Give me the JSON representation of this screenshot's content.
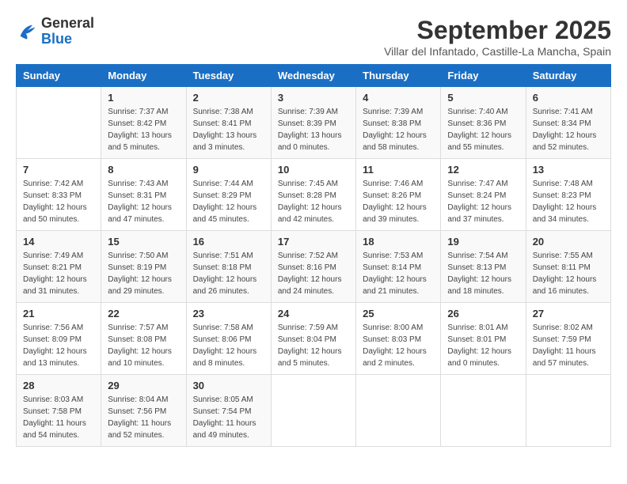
{
  "header": {
    "logo_general": "General",
    "logo_blue": "Blue",
    "month_title": "September 2025",
    "subtitle": "Villar del Infantado, Castille-La Mancha, Spain"
  },
  "weekdays": [
    "Sunday",
    "Monday",
    "Tuesday",
    "Wednesday",
    "Thursday",
    "Friday",
    "Saturday"
  ],
  "weeks": [
    [
      {
        "day": "",
        "sunrise": "",
        "sunset": "",
        "daylight": ""
      },
      {
        "day": "1",
        "sunrise": "Sunrise: 7:37 AM",
        "sunset": "Sunset: 8:42 PM",
        "daylight": "Daylight: 13 hours and 5 minutes."
      },
      {
        "day": "2",
        "sunrise": "Sunrise: 7:38 AM",
        "sunset": "Sunset: 8:41 PM",
        "daylight": "Daylight: 13 hours and 3 minutes."
      },
      {
        "day": "3",
        "sunrise": "Sunrise: 7:39 AM",
        "sunset": "Sunset: 8:39 PM",
        "daylight": "Daylight: 13 hours and 0 minutes."
      },
      {
        "day": "4",
        "sunrise": "Sunrise: 7:39 AM",
        "sunset": "Sunset: 8:38 PM",
        "daylight": "Daylight: 12 hours and 58 minutes."
      },
      {
        "day": "5",
        "sunrise": "Sunrise: 7:40 AM",
        "sunset": "Sunset: 8:36 PM",
        "daylight": "Daylight: 12 hours and 55 minutes."
      },
      {
        "day": "6",
        "sunrise": "Sunrise: 7:41 AM",
        "sunset": "Sunset: 8:34 PM",
        "daylight": "Daylight: 12 hours and 52 minutes."
      }
    ],
    [
      {
        "day": "7",
        "sunrise": "Sunrise: 7:42 AM",
        "sunset": "Sunset: 8:33 PM",
        "daylight": "Daylight: 12 hours and 50 minutes."
      },
      {
        "day": "8",
        "sunrise": "Sunrise: 7:43 AM",
        "sunset": "Sunset: 8:31 PM",
        "daylight": "Daylight: 12 hours and 47 minutes."
      },
      {
        "day": "9",
        "sunrise": "Sunrise: 7:44 AM",
        "sunset": "Sunset: 8:29 PM",
        "daylight": "Daylight: 12 hours and 45 minutes."
      },
      {
        "day": "10",
        "sunrise": "Sunrise: 7:45 AM",
        "sunset": "Sunset: 8:28 PM",
        "daylight": "Daylight: 12 hours and 42 minutes."
      },
      {
        "day": "11",
        "sunrise": "Sunrise: 7:46 AM",
        "sunset": "Sunset: 8:26 PM",
        "daylight": "Daylight: 12 hours and 39 minutes."
      },
      {
        "day": "12",
        "sunrise": "Sunrise: 7:47 AM",
        "sunset": "Sunset: 8:24 PM",
        "daylight": "Daylight: 12 hours and 37 minutes."
      },
      {
        "day": "13",
        "sunrise": "Sunrise: 7:48 AM",
        "sunset": "Sunset: 8:23 PM",
        "daylight": "Daylight: 12 hours and 34 minutes."
      }
    ],
    [
      {
        "day": "14",
        "sunrise": "Sunrise: 7:49 AM",
        "sunset": "Sunset: 8:21 PM",
        "daylight": "Daylight: 12 hours and 31 minutes."
      },
      {
        "day": "15",
        "sunrise": "Sunrise: 7:50 AM",
        "sunset": "Sunset: 8:19 PM",
        "daylight": "Daylight: 12 hours and 29 minutes."
      },
      {
        "day": "16",
        "sunrise": "Sunrise: 7:51 AM",
        "sunset": "Sunset: 8:18 PM",
        "daylight": "Daylight: 12 hours and 26 minutes."
      },
      {
        "day": "17",
        "sunrise": "Sunrise: 7:52 AM",
        "sunset": "Sunset: 8:16 PM",
        "daylight": "Daylight: 12 hours and 24 minutes."
      },
      {
        "day": "18",
        "sunrise": "Sunrise: 7:53 AM",
        "sunset": "Sunset: 8:14 PM",
        "daylight": "Daylight: 12 hours and 21 minutes."
      },
      {
        "day": "19",
        "sunrise": "Sunrise: 7:54 AM",
        "sunset": "Sunset: 8:13 PM",
        "daylight": "Daylight: 12 hours and 18 minutes."
      },
      {
        "day": "20",
        "sunrise": "Sunrise: 7:55 AM",
        "sunset": "Sunset: 8:11 PM",
        "daylight": "Daylight: 12 hours and 16 minutes."
      }
    ],
    [
      {
        "day": "21",
        "sunrise": "Sunrise: 7:56 AM",
        "sunset": "Sunset: 8:09 PM",
        "daylight": "Daylight: 12 hours and 13 minutes."
      },
      {
        "day": "22",
        "sunrise": "Sunrise: 7:57 AM",
        "sunset": "Sunset: 8:08 PM",
        "daylight": "Daylight: 12 hours and 10 minutes."
      },
      {
        "day": "23",
        "sunrise": "Sunrise: 7:58 AM",
        "sunset": "Sunset: 8:06 PM",
        "daylight": "Daylight: 12 hours and 8 minutes."
      },
      {
        "day": "24",
        "sunrise": "Sunrise: 7:59 AM",
        "sunset": "Sunset: 8:04 PM",
        "daylight": "Daylight: 12 hours and 5 minutes."
      },
      {
        "day": "25",
        "sunrise": "Sunrise: 8:00 AM",
        "sunset": "Sunset: 8:03 PM",
        "daylight": "Daylight: 12 hours and 2 minutes."
      },
      {
        "day": "26",
        "sunrise": "Sunrise: 8:01 AM",
        "sunset": "Sunset: 8:01 PM",
        "daylight": "Daylight: 12 hours and 0 minutes."
      },
      {
        "day": "27",
        "sunrise": "Sunrise: 8:02 AM",
        "sunset": "Sunset: 7:59 PM",
        "daylight": "Daylight: 11 hours and 57 minutes."
      }
    ],
    [
      {
        "day": "28",
        "sunrise": "Sunrise: 8:03 AM",
        "sunset": "Sunset: 7:58 PM",
        "daylight": "Daylight: 11 hours and 54 minutes."
      },
      {
        "day": "29",
        "sunrise": "Sunrise: 8:04 AM",
        "sunset": "Sunset: 7:56 PM",
        "daylight": "Daylight: 11 hours and 52 minutes."
      },
      {
        "day": "30",
        "sunrise": "Sunrise: 8:05 AM",
        "sunset": "Sunset: 7:54 PM",
        "daylight": "Daylight: 11 hours and 49 minutes."
      },
      {
        "day": "",
        "sunrise": "",
        "sunset": "",
        "daylight": ""
      },
      {
        "day": "",
        "sunrise": "",
        "sunset": "",
        "daylight": ""
      },
      {
        "day": "",
        "sunrise": "",
        "sunset": "",
        "daylight": ""
      },
      {
        "day": "",
        "sunrise": "",
        "sunset": "",
        "daylight": ""
      }
    ]
  ]
}
